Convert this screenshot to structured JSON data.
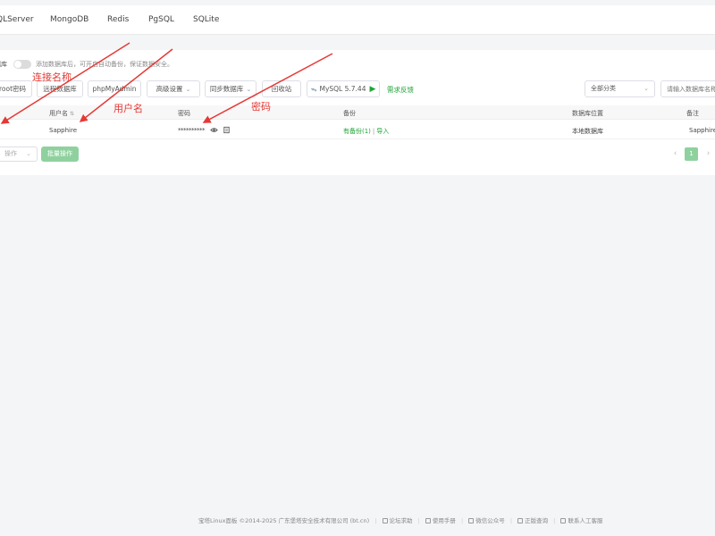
{
  "tabs": [
    "QLServer",
    "MongoDB",
    "Redis",
    "PgSQL",
    "SQLite"
  ],
  "toolbar": {
    "toggle_label": "据库",
    "toggle_hint": "添加数据库后，可开启自动备份，保证数据安全。",
    "root_password": "root密码",
    "remote_db": "远程数据库",
    "phpmyadmin": "phpMyAdmin",
    "advanced": "高级设置",
    "sync_db": "同步数据库",
    "recycle_bin": "回收站",
    "mysql_version": "MySQL 5.7.44",
    "feedback": "需求反馈",
    "category": "全部分类",
    "search_placeholder": "请输入数据库名称"
  },
  "table": {
    "headers": {
      "username": "用户名",
      "password": "密码",
      "backup": "备份",
      "location": "数据库位置",
      "note": "备注"
    },
    "rows": [
      {
        "username": "Sapphire",
        "password_masked": "**********",
        "backup": "有备份(1)",
        "backup_sep": "|",
        "import": "导入",
        "location": "本地数据库",
        "note": "Sapphire"
      }
    ]
  },
  "bottom": {
    "batch_select": "操作",
    "batch_button": "批量操作",
    "current_page": "1"
  },
  "annotations": {
    "connection_name": "连接名称",
    "username": "用户名",
    "password": "密码"
  },
  "footer": {
    "copyright": "宝塔Linux面板 ©2014-2025 广东堡塔安全技术有限公司 (bt.cn)",
    "links": [
      "论坛求助",
      "使用手册",
      "微信公众号",
      "正版查询",
      "联系人工客服"
    ]
  },
  "colors": {
    "accent_green": "#20a53a",
    "annotation_red": "#e53935"
  }
}
